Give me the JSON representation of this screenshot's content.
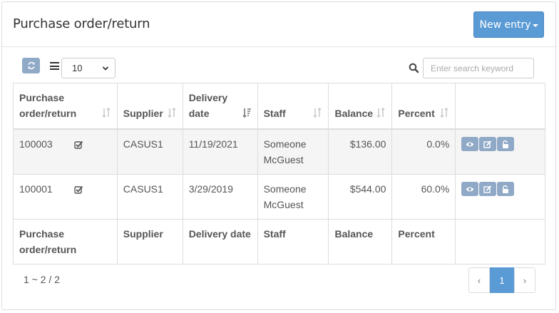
{
  "header": {
    "title": "Purchase order/return",
    "new_entry_label": "New entry"
  },
  "toolbar": {
    "refresh_icon": "refresh-icon",
    "columns_icon": "list-icon",
    "page_size": "10",
    "search_placeholder": "Enter search keyword",
    "search_icon": "search-icon"
  },
  "table": {
    "columns": [
      {
        "label_line1": "Purchase",
        "label_line2": "order/return"
      },
      {
        "label": "Supplier"
      },
      {
        "label_line1": "Delivery",
        "label_line2": "date"
      },
      {
        "label": "Staff"
      },
      {
        "label": "Balance"
      },
      {
        "label": "Percent"
      },
      {
        "label": ""
      }
    ],
    "rows": [
      {
        "order": "100003",
        "supplier": "CASUS1",
        "delivery_date": "11/19/2021",
        "staff_line1": "Someone",
        "staff_line2": "McGuest",
        "balance": "$136.00",
        "percent": "0.0%"
      },
      {
        "order": "100001",
        "supplier": "CASUS1",
        "delivery_date": "3/29/2019",
        "staff_line1": "Someone",
        "staff_line2": "McGuest",
        "balance": "$544.00",
        "percent": "60.0%"
      }
    ],
    "footer": {
      "order_line1": "Purchase",
      "order_line2": "order/return",
      "supplier": "Supplier",
      "delivery_date": "Delivery date",
      "staff": "Staff",
      "balance": "Balance",
      "percent": "Percent"
    }
  },
  "pager": {
    "info": "1 ~ 2 / 2",
    "prev": "‹",
    "current": "1",
    "next": "›"
  },
  "colors": {
    "primary": "#5b9bd5",
    "action_button": "#8fa9c6"
  }
}
